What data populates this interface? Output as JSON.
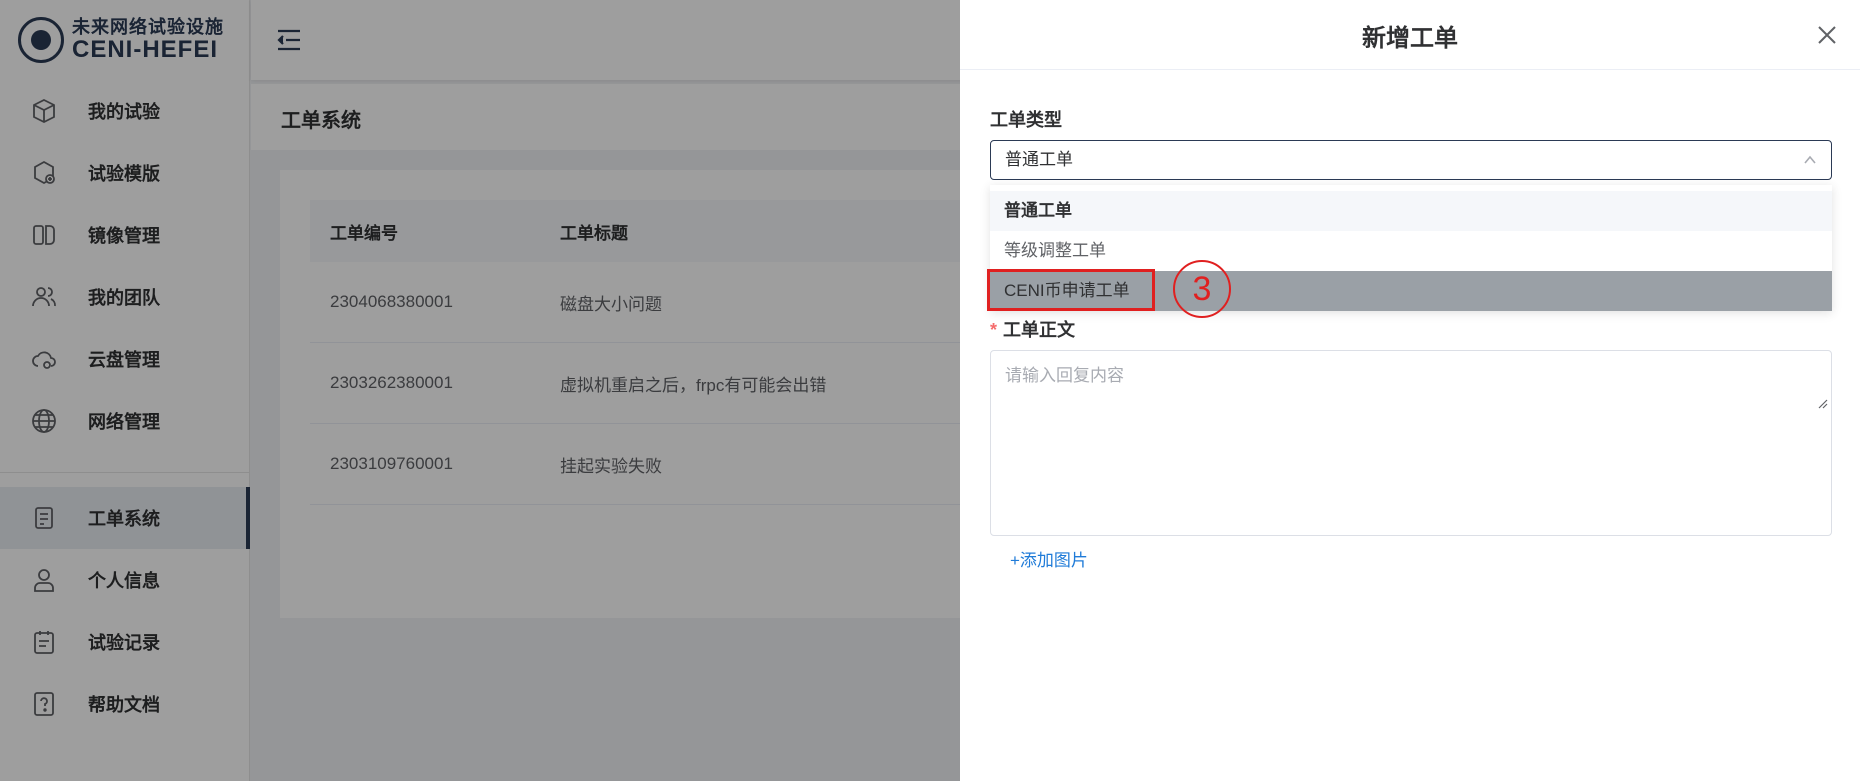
{
  "logo": {
    "cn": "未来网络试验设施",
    "en": "CENI-HEFEI"
  },
  "sidebar": {
    "items": [
      {
        "label": "我的试验",
        "icon": "experiment-icon"
      },
      {
        "label": "试验模版",
        "icon": "template-icon"
      },
      {
        "label": "镜像管理",
        "icon": "image-icon"
      },
      {
        "label": "我的团队",
        "icon": "team-icon"
      },
      {
        "label": "云盘管理",
        "icon": "cloud-disk-icon"
      },
      {
        "label": "网络管理",
        "icon": "globe-icon"
      }
    ],
    "items2": [
      {
        "label": "工单系统",
        "icon": "ticket-icon",
        "active": true
      },
      {
        "label": "个人信息",
        "icon": "user-icon"
      },
      {
        "label": "试验记录",
        "icon": "record-icon"
      },
      {
        "label": "帮助文档",
        "icon": "help-icon"
      }
    ]
  },
  "page": {
    "title": "工单系统"
  },
  "table": {
    "headers": [
      "工单编号",
      "工单标题"
    ],
    "rows": [
      [
        "2304068380001",
        "磁盘大小问题"
      ],
      [
        "2303262380001",
        "虚拟机重启之后，frpc有可能会出错"
      ],
      [
        "2303109760001",
        "挂起实验失败"
      ]
    ]
  },
  "drawer": {
    "title": "新增工单",
    "type_label": "工单类型",
    "type_value": "普通工单",
    "options": [
      "普通工单",
      "等级调整工单",
      "CENI币申请工单"
    ],
    "body_label": "工单正文",
    "body_placeholder": "请输入回复内容",
    "add_image": "+添加图片"
  },
  "annotation": {
    "step": "3"
  },
  "colors": {
    "primary": "#2b3a55",
    "link": "#1f7bd8",
    "annotation": "#e02020"
  }
}
